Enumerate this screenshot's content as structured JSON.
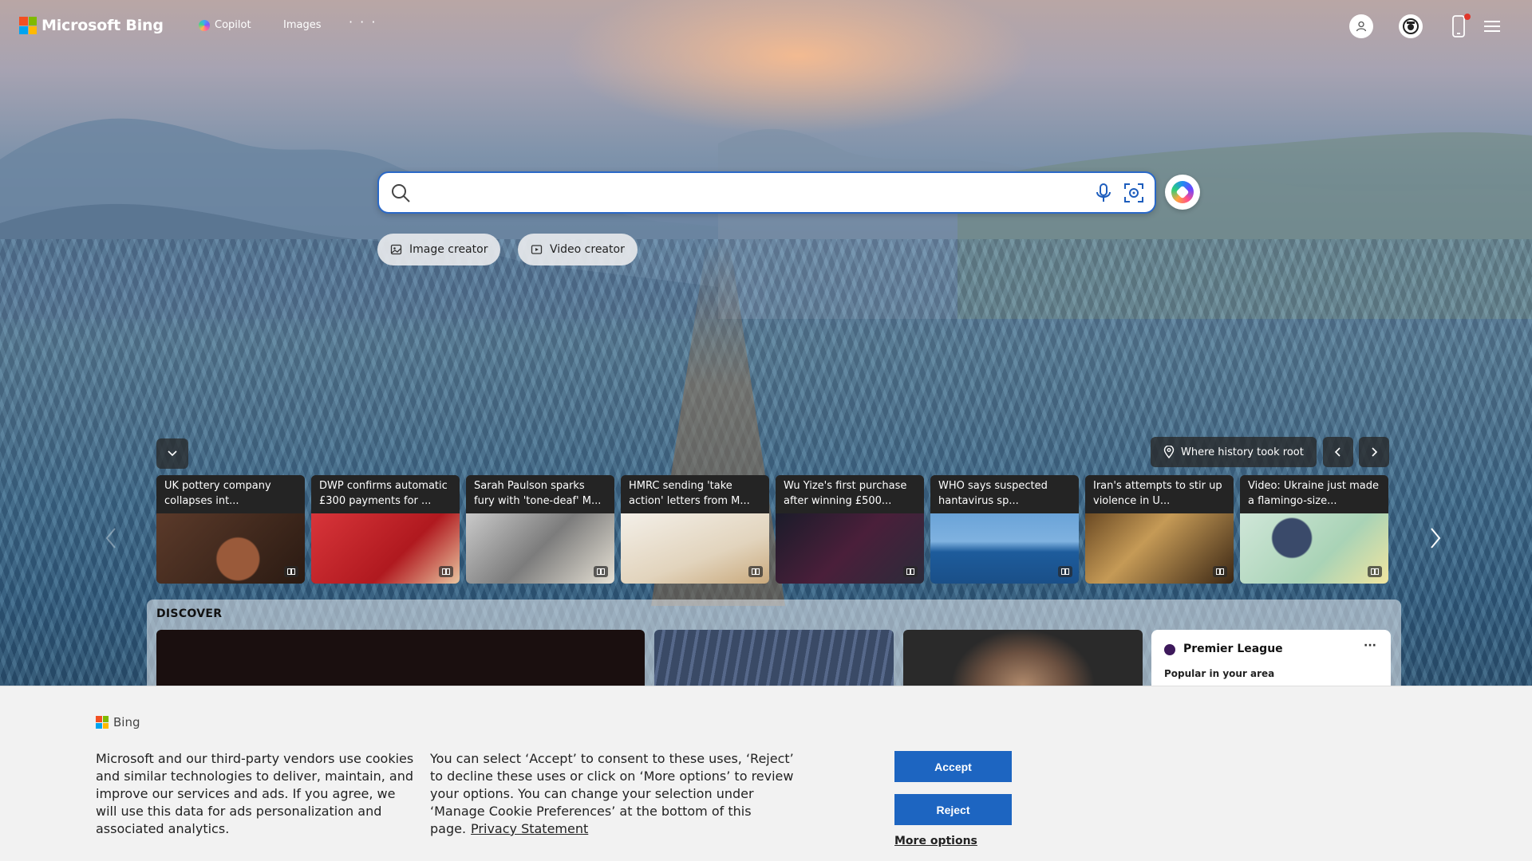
{
  "brand": {
    "logo_text": "Microsoft Bing",
    "ms_colors": [
      "#f25022",
      "#7fba00",
      "#00a4ef",
      "#ffb900"
    ]
  },
  "header": {
    "nav": [
      {
        "label": "Copilot",
        "icon": "copilot-icon"
      },
      {
        "label": "Images"
      }
    ],
    "more_label": "· · ·",
    "icons": [
      "user-icon",
      "rewards-icon",
      "mobile-icon",
      "hamburger-menu-icon"
    ]
  },
  "search": {
    "value": "",
    "placeholder": "",
    "accent": "#2a68c7"
  },
  "chips": [
    {
      "label": "Image creator",
      "icon": "image-creator-icon"
    },
    {
      "label": "Video creator",
      "icon": "video-creator-icon"
    }
  ],
  "location": {
    "label": "Where history took root"
  },
  "news": [
    {
      "title": "UK pottery company collapses int..."
    },
    {
      "title": "DWP confirms automatic £300 payments for ..."
    },
    {
      "title": "Sarah Paulson sparks fury with 'tone-deaf' M..."
    },
    {
      "title": "HMRC sending 'take action' letters from M..."
    },
    {
      "title": "Wu Yize's first purchase after winning £500..."
    },
    {
      "title": "WHO says suspected hantavirus sp..."
    },
    {
      "title": "Iran's attempts to stir up violence in U..."
    },
    {
      "title": "Video: Ukraine just made a flamingo-size..."
    }
  ],
  "discover": {
    "label": "DISCOVER",
    "widget": {
      "title": "Premier League",
      "subtitle": "Popular in your area",
      "more": "···"
    }
  },
  "cookie": {
    "brand": "Bing",
    "text1": "Microsoft and our third-party vendors use cookies and similar technologies to deliver, maintain, and improve our services and ads. If you agree, we will use this data for ads personalization and associated analytics.",
    "text2": "You can select ‘Accept’ to consent to these uses, ‘Reject’ to decline these uses or click on ‘More options’ to review your options. You can change your selection under ‘Manage Cookie Preferences’ at the bottom of this page.",
    "privacy_link": "Privacy Statement",
    "accept": "Accept",
    "reject": "Reject",
    "more_options": "More options",
    "button_color": "#1d65c1"
  }
}
